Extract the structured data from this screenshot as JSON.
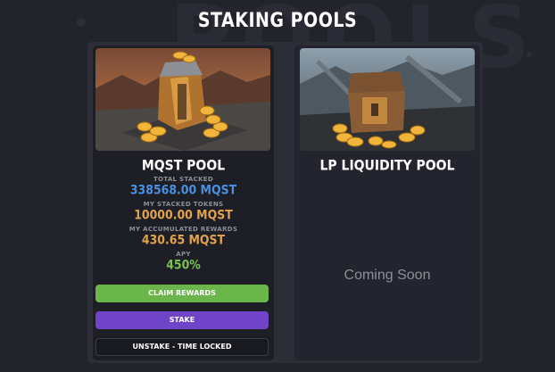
{
  "header": {
    "title": "STAKING POOLS",
    "watermark": "POOLS"
  },
  "pools": [
    {
      "name": "MQST POOL",
      "total_staked_label": "TOTAL STACKED",
      "total_staked_value": "338568.00 MQST",
      "my_staked_label": "MY STACKED TOKENS",
      "my_staked_value": "10000.00 MQST",
      "rewards_label": "MY ACCUMULATED REWARDS",
      "rewards_value": "430.65 MQST",
      "apy_label": "APY",
      "apy_value": "450%",
      "buttons": {
        "claim": "CLAIM REWARDS",
        "stake": "STAKE",
        "unstake": "UNSTAKE - TIME LOCKED"
      }
    },
    {
      "name": "LP LIQUIDITY POOL",
      "status": "Coming Soon"
    }
  ],
  "colors": {
    "background": "#23232c",
    "card": "#1d1e26",
    "total_staked": "#4a8fe0",
    "my_staked": "#e2a24c",
    "rewards": "#e2a24c",
    "apy": "#7cc14d",
    "claim_button": "#6ab64a",
    "stake_button": "#6f44c8",
    "unstake_button": "#191a20"
  },
  "icons": {
    "pool_image_1": "treasure-cart-image",
    "pool_image_2": "treasure-chest-image"
  }
}
